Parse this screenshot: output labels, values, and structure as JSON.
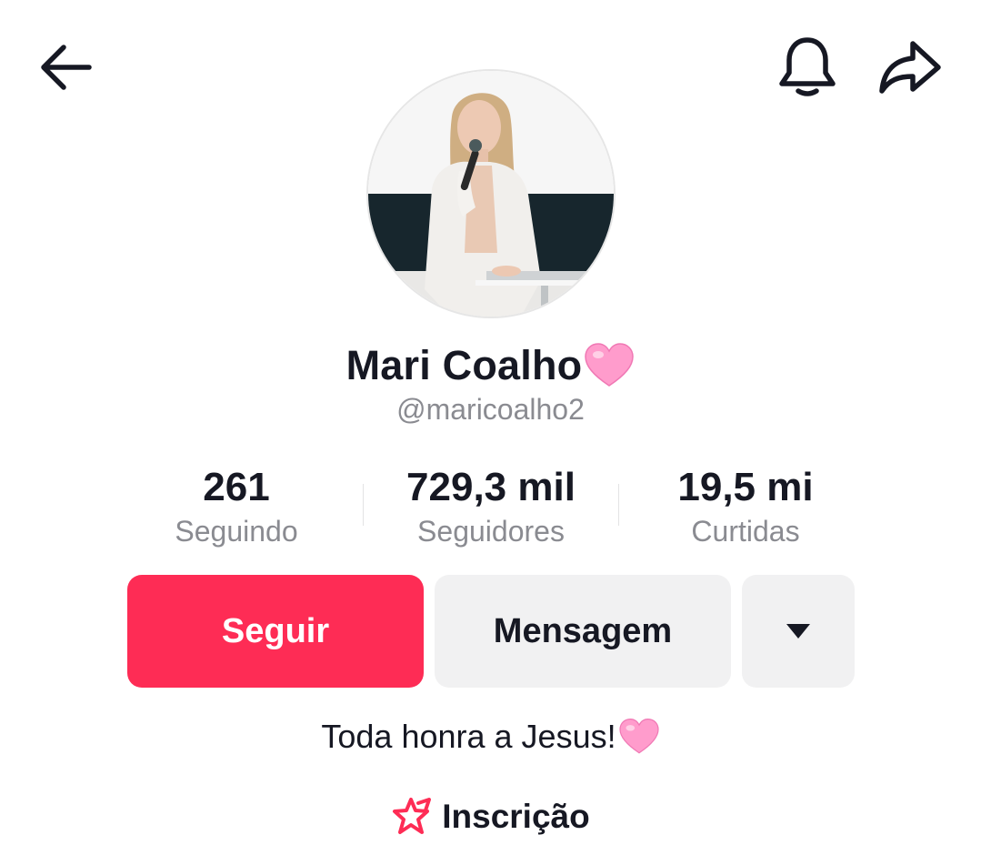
{
  "header": {
    "back_icon": "arrow-left-icon",
    "notification_icon": "bell-icon",
    "share_icon": "share-arrow-icon"
  },
  "profile": {
    "name": "Mari Coalho",
    "name_emoji": "pink-heart",
    "handle": "@maricoalho2",
    "avatar": "woman-singing-on-stage-photo"
  },
  "stats": [
    {
      "value": "261",
      "label": "Seguindo"
    },
    {
      "value": "729,3 mil",
      "label": "Seguidores"
    },
    {
      "value": "19,5 mi",
      "label": "Curtidas"
    }
  ],
  "actions": {
    "follow_label": "Seguir",
    "message_label": "Mensagem",
    "more_icon": "caret-down-icon"
  },
  "bio": {
    "text": "Toda honra a Jesus!",
    "emoji": "pink-heart"
  },
  "subscription": {
    "label": "Inscrição",
    "icon": "star-subscription-icon"
  },
  "colors": {
    "follow_bg": "#fe2c55",
    "secondary_bg": "#f1f1f2",
    "muted_text": "#8a8b91",
    "text": "#161823",
    "heart": "#ff8fc8"
  }
}
